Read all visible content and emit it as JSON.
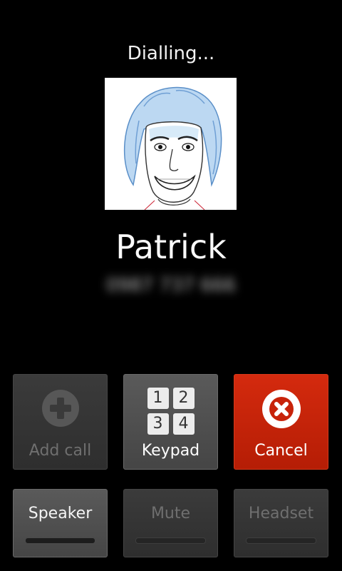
{
  "call": {
    "status": "Dialling...",
    "contact_name": "Patrick",
    "number": "0987 737 666"
  },
  "actions": {
    "add_call": "Add call",
    "keypad": "Keypad",
    "cancel": "Cancel",
    "keypad_keys": [
      "1",
      "2",
      "3",
      "4"
    ]
  },
  "toggles": {
    "speaker": "Speaker",
    "mute": "Mute",
    "headset": "Headset"
  },
  "icons": {
    "add_call": "plus-circle-icon",
    "keypad": "keypad-grid-icon",
    "cancel": "x-circle-icon"
  },
  "colors": {
    "background": "#000000",
    "cancel_red": "#c8230a",
    "button_grey": "#4a4a4a",
    "disabled_text": "#6f6f6f"
  }
}
